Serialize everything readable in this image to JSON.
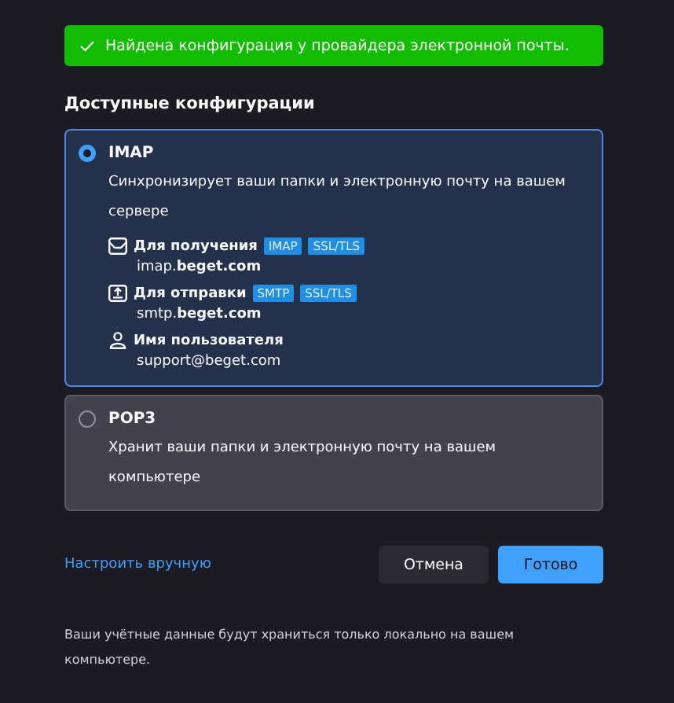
{
  "banner": {
    "text": "Найдена конфигурация у провайдера электронной почты."
  },
  "heading": "Доступные конфигурации",
  "configs": [
    {
      "name": "IMAP",
      "selected": true,
      "description": "Синхронизирует ваши папки и электронную почту на вашем сервере",
      "details": [
        {
          "kind": "incoming",
          "label": "Для получения",
          "tags": [
            "IMAP",
            "SSL/TLS"
          ],
          "value": "imap.**beget.com**"
        },
        {
          "kind": "outgoing",
          "label": "Для отправки",
          "tags": [
            "SMTP",
            "SSL/TLS"
          ],
          "value": "smtp.**beget.com**"
        },
        {
          "kind": "user",
          "label": "Имя пользователя",
          "value": "support@beget.com"
        }
      ]
    },
    {
      "name": "POP3",
      "selected": false,
      "description": "Хранит ваши папки и электронную почту на вашем компьютере"
    }
  ],
  "manual_link": "Настроить вручную",
  "buttons": [
    {
      "label": "Отмена",
      "kind": "secondary"
    },
    {
      "label": "Готово",
      "kind": "primary"
    }
  ],
  "footer": "Ваши учётные данные будут храниться только локально на вашем компьютере."
}
